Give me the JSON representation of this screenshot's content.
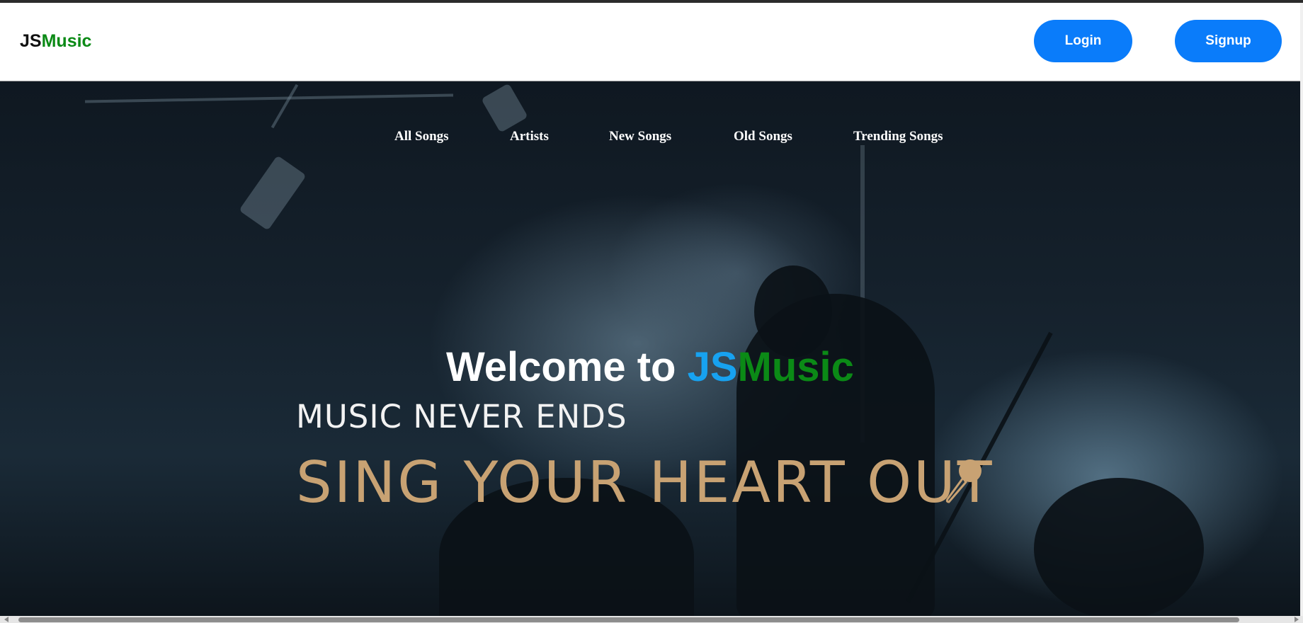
{
  "header": {
    "logo_js": "JS",
    "logo_music": "Music",
    "login_label": "Login",
    "signup_label": "Signup"
  },
  "nav": {
    "items": [
      {
        "label": "All Songs"
      },
      {
        "label": "Artists"
      },
      {
        "label": "New Songs"
      },
      {
        "label": "Old Songs"
      },
      {
        "label": "Trending Songs"
      }
    ]
  },
  "hero": {
    "welcome_prefix": "Welcome to ",
    "welcome_js": "JS",
    "welcome_music": "Music",
    "tagline_top": "MUSIC NEVER ENDS",
    "tagline_bottom": "SING YOUR HEART OUT",
    "mic_icon": "microphone-icon"
  },
  "colors": {
    "accent_blue": "#0a7cfa",
    "brand_green": "#0b8a16",
    "welcome_js_blue": "#17a2f0",
    "tagline_gold": "#c8a273"
  }
}
